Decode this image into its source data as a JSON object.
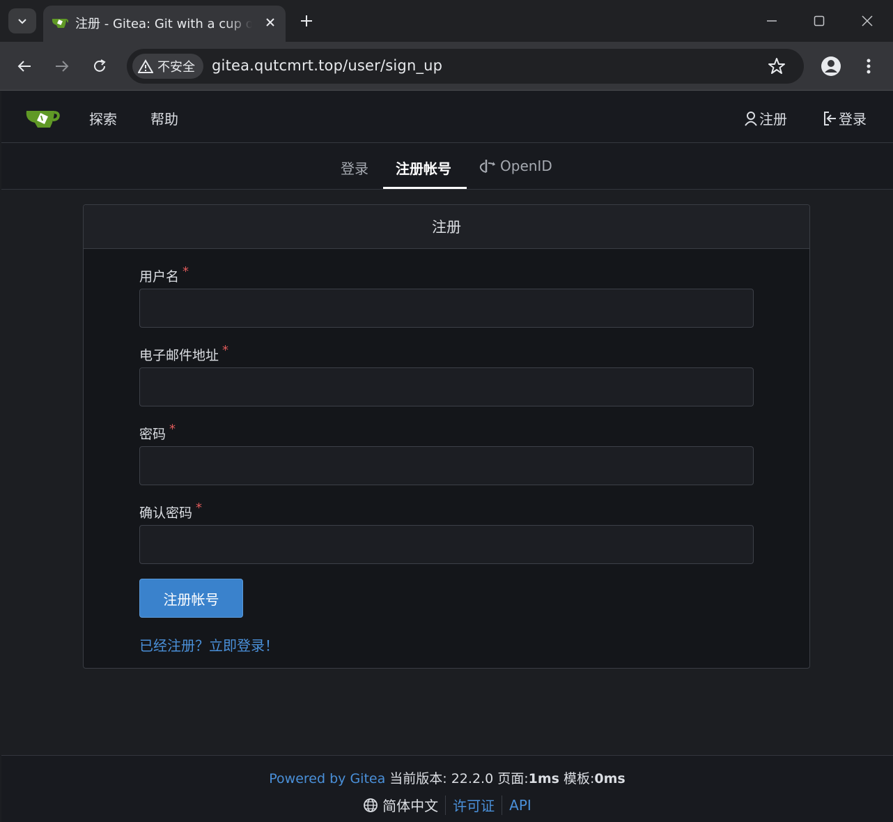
{
  "browser": {
    "tab_title": "注册 - Gitea: Git with a cup of tea",
    "security_label": "不安全",
    "url": "gitea.qutcmrt.top/user/sign_up"
  },
  "navbar": {
    "explore": "探索",
    "help": "帮助",
    "register": "注册",
    "signin": "登录"
  },
  "subtabs": {
    "signin": "登录",
    "register": "注册帐号",
    "openid": "OpenID"
  },
  "form": {
    "title": "注册",
    "username_label": "用户名",
    "email_label": "电子邮件地址",
    "password_label": "密码",
    "confirm_label": "确认密码",
    "required_mark": "*",
    "username_value": "",
    "email_value": "",
    "password_value": "",
    "confirm_value": "",
    "submit_label": "注册帐号",
    "signin_link": "已经注册？立即登录！"
  },
  "footer": {
    "powered": "Powered by Gitea",
    "version_label": "当前版本: 22.2.0",
    "page_label": "页面:",
    "page_time": "1ms",
    "template_label": "模板:",
    "template_time": "0ms",
    "language": "简体中文",
    "license": "许可证",
    "api": "API"
  },
  "colors": {
    "accent": "#3a82cc",
    "link": "#4a90d9",
    "required": "#e05a5a",
    "gitea_green": "#609926"
  }
}
